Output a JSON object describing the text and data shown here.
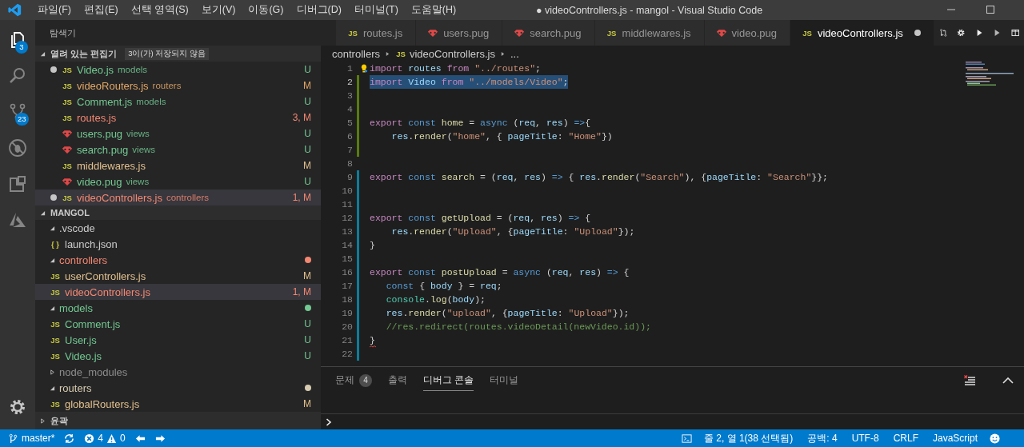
{
  "title_bar": {
    "menu": [
      "파일(F)",
      "편집(E)",
      "선택 영역(S)",
      "보기(V)",
      "이동(G)",
      "디버그(D)",
      "터미널(T)",
      "도움말(H)"
    ],
    "title": "● videoControllers.js - mangol - Visual Studio Code"
  },
  "activity_bar": [
    {
      "kind": "explorer",
      "selected": true,
      "badge": "3"
    },
    {
      "kind": "search",
      "selected": false
    },
    {
      "kind": "scm",
      "selected": false,
      "badge": "23"
    },
    {
      "kind": "debug",
      "selected": false
    },
    {
      "kind": "extensions",
      "selected": false
    },
    {
      "kind": "azure",
      "selected": false
    }
  ],
  "sidebar": {
    "title": "탐색기",
    "open_editors": {
      "title": "열려 있는 편집기",
      "expanded": true,
      "badge": "3이(가) 저장되지 않음",
      "items": [
        {
          "kind": "glyph",
          "icon": "JS",
          "name": "Video.js",
          "detail": "models",
          "status": "U",
          "color": "#73c991",
          "dirty": true,
          "selected": false
        },
        {
          "kind": "glyph",
          "icon": "JS",
          "name": "videoRouters.js",
          "detail": "routers",
          "status": "M",
          "color": "#e2a766",
          "dirty": false,
          "selected": false
        },
        {
          "kind": "glyph",
          "icon": "JS",
          "name": "Comment.js",
          "detail": "models",
          "status": "U",
          "color": "#73c991",
          "dirty": false,
          "selected": false
        },
        {
          "kind": "glyph",
          "icon": "JS",
          "name": "routes.js",
          "status": "3, M",
          "color": "#f48771",
          "dirty": false,
          "selected": false
        },
        {
          "kind": "pug",
          "name": "users.pug",
          "detail": "views",
          "status": "U",
          "color": "#73c991",
          "dirty": false,
          "selected": false
        },
        {
          "kind": "pug",
          "name": "search.pug",
          "detail": "views",
          "status": "U",
          "color": "#73c991",
          "dirty": false,
          "selected": false
        },
        {
          "kind": "glyph",
          "icon": "JS",
          "name": "middlewares.js",
          "status": "M",
          "color": "#e2c08d",
          "dirty": false,
          "selected": false
        },
        {
          "kind": "pug",
          "name": "video.pug",
          "detail": "views",
          "status": "U",
          "color": "#73c991",
          "dirty": false,
          "selected": false
        },
        {
          "kind": "glyph",
          "icon": "JS",
          "name": "videoControllers.js",
          "detail": "controllers",
          "status": "1, M",
          "color": "#f48771",
          "dirty": true,
          "selected": true
        }
      ]
    },
    "workspace": {
      "title": "MANGOL",
      "expanded": true,
      "tree": [
        {
          "kind": "folder",
          "name": ".vscode",
          "expanded": true,
          "color": "#cccccc",
          "children": [
            {
              "kind": "glyph",
              "icon": "{ }",
              "name": "launch.json",
              "color": "#cccccc",
              "selected": false
            }
          ]
        },
        {
          "kind": "folder",
          "name": "controllers",
          "expanded": true,
          "color": "#f48771",
          "dot": true,
          "children": [
            {
              "kind": "glyph",
              "icon": "JS",
              "name": "userControllers.js",
              "status": "M",
              "color": "#e2c08d",
              "selected": false
            },
            {
              "kind": "glyph",
              "icon": "JS",
              "name": "videoControllers.js",
              "status": "1, M",
              "color": "#f48771",
              "selected": true
            }
          ]
        },
        {
          "kind": "folder",
          "name": "models",
          "expanded": true,
          "color": "#73c991",
          "dot": true,
          "children": [
            {
              "kind": "glyph",
              "icon": "JS",
              "name": "Comment.js",
              "status": "U",
              "color": "#73c991",
              "selected": false
            },
            {
              "kind": "glyph",
              "icon": "JS",
              "name": "User.js",
              "status": "U",
              "color": "#73c991",
              "selected": false
            },
            {
              "kind": "glyph",
              "icon": "JS",
              "name": "Video.js",
              "status": "U",
              "color": "#73c991",
              "selected": false
            }
          ]
        },
        {
          "kind": "folder",
          "name": "node_modules",
          "expanded": false,
          "color": "#8c8c8c"
        },
        {
          "kind": "folder",
          "name": "routers",
          "expanded": true,
          "color": "#d7ccb0",
          "dot": true,
          "children": [
            {
              "kind": "glyph",
              "icon": "JS",
              "name": "globalRouters.js",
              "status": "M",
              "color": "#e2c08d",
              "selected": false
            }
          ]
        }
      ]
    },
    "outline": {
      "title": "윤곽",
      "expanded": false
    }
  },
  "tabs": [
    {
      "kind": "glyph",
      "icon": "JS",
      "name": "routes.js",
      "selected": false,
      "dirty": false
    },
    {
      "kind": "pug",
      "name": "users.pug",
      "selected": false,
      "dirty": false
    },
    {
      "kind": "pug",
      "name": "search.pug",
      "selected": false,
      "dirty": false
    },
    {
      "kind": "glyph",
      "icon": "JS",
      "name": "middlewares.js",
      "selected": false,
      "dirty": false
    },
    {
      "kind": "pug",
      "name": "video.pug",
      "selected": false,
      "dirty": false
    },
    {
      "kind": "glyph",
      "icon": "JS",
      "name": "videoControllers.js",
      "selected": true,
      "dirty": true
    }
  ],
  "breadcrumb": [
    {
      "kind": "folder",
      "text": "controllers"
    },
    {
      "kind": "glyph",
      "icon": "JS",
      "text": "videoControllers.js"
    },
    {
      "kind": "more",
      "text": "..."
    }
  ],
  "code": [
    {
      "n": "1",
      "kind": "plain",
      "selected": false,
      "error": false,
      "tokens": [
        {
          "kind": "keyword",
          "text": "import "
        },
        {
          "kind": "variable",
          "text": "routes "
        },
        {
          "kind": "keyword",
          "text": "from "
        },
        {
          "kind": "string",
          "text": "\"../routes\""
        },
        {
          "kind": "plain",
          "text": ";"
        }
      ]
    },
    {
      "n": "2",
      "kind": "added",
      "selected": true,
      "error": false,
      "tokens": [
        {
          "kind": "keyword",
          "text": "import "
        },
        {
          "kind": "variable",
          "text": "Video "
        },
        {
          "kind": "keyword",
          "text": "from "
        },
        {
          "kind": "string",
          "text": "\"../models/Video\""
        },
        {
          "kind": "plain",
          "text": ";"
        }
      ]
    },
    {
      "n": "3",
      "kind": "added",
      "selected": false,
      "error": false
    },
    {
      "n": "4",
      "kind": "added",
      "selected": false,
      "error": false
    },
    {
      "n": "5",
      "kind": "added",
      "selected": false,
      "error": false,
      "tokens": [
        {
          "kind": "keyword",
          "text": "export "
        },
        {
          "kind": "storage",
          "text": "const "
        },
        {
          "kind": "function",
          "text": "home "
        },
        {
          "kind": "plain",
          "text": "= "
        },
        {
          "kind": "storage",
          "text": "async "
        },
        {
          "kind": "plain",
          "text": "("
        },
        {
          "kind": "variable",
          "text": "req"
        },
        {
          "kind": "plain",
          "text": ", "
        },
        {
          "kind": "variable",
          "text": "res"
        },
        {
          "kind": "plain",
          "text": ") "
        },
        {
          "kind": "storage",
          "text": "=>"
        },
        {
          "kind": "plain",
          "text": "{"
        }
      ]
    },
    {
      "n": "6",
      "kind": "added",
      "selected": false,
      "error": false,
      "tokens": [
        {
          "kind": "variable",
          "text": "    res"
        },
        {
          "kind": "plain",
          "text": "."
        },
        {
          "kind": "function",
          "text": "render"
        },
        {
          "kind": "plain",
          "text": "("
        },
        {
          "kind": "string",
          "text": "\"home\""
        },
        {
          "kind": "plain",
          "text": ", { "
        },
        {
          "kind": "variable",
          "text": "pageTitle"
        },
        {
          "kind": "plain",
          "text": ": "
        },
        {
          "kind": "string",
          "text": "\"Home\""
        },
        {
          "kind": "plain",
          "text": "})"
        }
      ]
    },
    {
      "n": "7",
      "kind": "added",
      "selected": false,
      "error": false
    },
    {
      "n": "8",
      "kind": "plain",
      "selected": false,
      "error": false
    },
    {
      "n": "9",
      "kind": "modified",
      "selected": false,
      "error": false,
      "tokens": [
        {
          "kind": "keyword",
          "text": "export "
        },
        {
          "kind": "storage",
          "text": "const "
        },
        {
          "kind": "function",
          "text": "search "
        },
        {
          "kind": "plain",
          "text": "= ("
        },
        {
          "kind": "variable",
          "text": "req"
        },
        {
          "kind": "plain",
          "text": ", "
        },
        {
          "kind": "variable",
          "text": "res"
        },
        {
          "kind": "plain",
          "text": ") "
        },
        {
          "kind": "storage",
          "text": "=>"
        },
        {
          "kind": "plain",
          "text": " { "
        },
        {
          "kind": "variable",
          "text": "res"
        },
        {
          "kind": "plain",
          "text": "."
        },
        {
          "kind": "function",
          "text": "render"
        },
        {
          "kind": "plain",
          "text": "("
        },
        {
          "kind": "string",
          "text": "\"Search\""
        },
        {
          "kind": "plain",
          "text": "), {"
        },
        {
          "kind": "variable",
          "text": "pageTitle"
        },
        {
          "kind": "plain",
          "text": ": "
        },
        {
          "kind": "string",
          "text": "\"Search\""
        },
        {
          "kind": "plain",
          "text": "}};"
        }
      ]
    },
    {
      "n": "10",
      "kind": "modified",
      "selected": false,
      "error": false
    },
    {
      "n": "11",
      "kind": "modified",
      "selected": false,
      "error": false
    },
    {
      "n": "12",
      "kind": "modified",
      "selected": false,
      "error": false,
      "tokens": [
        {
          "kind": "keyword",
          "text": "export "
        },
        {
          "kind": "storage",
          "text": "const "
        },
        {
          "kind": "function",
          "text": "getUpload "
        },
        {
          "kind": "plain",
          "text": "= ("
        },
        {
          "kind": "variable",
          "text": "req"
        },
        {
          "kind": "plain",
          "text": ", "
        },
        {
          "kind": "variable",
          "text": "res"
        },
        {
          "kind": "plain",
          "text": ") "
        },
        {
          "kind": "storage",
          "text": "=>"
        },
        {
          "kind": "plain",
          "text": " {"
        }
      ]
    },
    {
      "n": "13",
      "kind": "modified",
      "selected": false,
      "error": false,
      "tokens": [
        {
          "kind": "variable",
          "text": "    res"
        },
        {
          "kind": "plain",
          "text": "."
        },
        {
          "kind": "function",
          "text": "render"
        },
        {
          "kind": "plain",
          "text": "("
        },
        {
          "kind": "string",
          "text": "\"Upload\""
        },
        {
          "kind": "plain",
          "text": ", {"
        },
        {
          "kind": "variable",
          "text": "pageTitle"
        },
        {
          "kind": "plain",
          "text": ": "
        },
        {
          "kind": "string",
          "text": "\"Upload\""
        },
        {
          "kind": "plain",
          "text": "});"
        }
      ]
    },
    {
      "n": "14",
      "kind": "modified",
      "selected": false,
      "error": false,
      "tokens": [
        {
          "kind": "plain",
          "text": "}"
        }
      ]
    },
    {
      "n": "15",
      "kind": "modified",
      "selected": false,
      "error": false
    },
    {
      "n": "16",
      "kind": "modified",
      "selected": false,
      "error": false,
      "tokens": [
        {
          "kind": "keyword",
          "text": "export "
        },
        {
          "kind": "storage",
          "text": "const "
        },
        {
          "kind": "function",
          "text": "postUpload "
        },
        {
          "kind": "plain",
          "text": "= "
        },
        {
          "kind": "storage",
          "text": "async "
        },
        {
          "kind": "plain",
          "text": "("
        },
        {
          "kind": "variable",
          "text": "req"
        },
        {
          "kind": "plain",
          "text": ", "
        },
        {
          "kind": "variable",
          "text": "res"
        },
        {
          "kind": "plain",
          "text": ") "
        },
        {
          "kind": "storage",
          "text": "=>"
        },
        {
          "kind": "plain",
          "text": " {"
        }
      ]
    },
    {
      "n": "17",
      "kind": "modified",
      "selected": false,
      "error": false,
      "tokens": [
        {
          "kind": "storage",
          "text": "   const "
        },
        {
          "kind": "plain",
          "text": "{ "
        },
        {
          "kind": "variable",
          "text": "body "
        },
        {
          "kind": "plain",
          "text": "} = "
        },
        {
          "kind": "variable",
          "text": "req"
        },
        {
          "kind": "plain",
          "text": ";"
        }
      ]
    },
    {
      "n": "18",
      "kind": "modified",
      "selected": false,
      "error": false,
      "tokens": [
        {
          "kind": "type",
          "text": "   console"
        },
        {
          "kind": "plain",
          "text": "."
        },
        {
          "kind": "function",
          "text": "log"
        },
        {
          "kind": "plain",
          "text": "("
        },
        {
          "kind": "variable",
          "text": "body"
        },
        {
          "kind": "plain",
          "text": ");"
        }
      ]
    },
    {
      "n": "19",
      "kind": "modified",
      "selected": false,
      "error": false,
      "tokens": [
        {
          "kind": "variable",
          "text": "   res"
        },
        {
          "kind": "plain",
          "text": "."
        },
        {
          "kind": "function",
          "text": "render"
        },
        {
          "kind": "plain",
          "text": "("
        },
        {
          "kind": "string",
          "text": "\"upload\""
        },
        {
          "kind": "plain",
          "text": ", {"
        },
        {
          "kind": "variable",
          "text": "pageTitle"
        },
        {
          "kind": "plain",
          "text": ": "
        },
        {
          "kind": "string",
          "text": "\"Upload\""
        },
        {
          "kind": "plain",
          "text": "});"
        }
      ]
    },
    {
      "n": "20",
      "kind": "modified",
      "selected": false,
      "error": false,
      "tokens": [
        {
          "kind": "comment",
          "text": "   //res.redirect(routes.videoDetail(newVideo.id));"
        }
      ]
    },
    {
      "n": "21",
      "kind": "modified",
      "selected": false,
      "error": true,
      "tokens": [
        {
          "kind": "plain",
          "text": "}"
        }
      ]
    },
    {
      "n": "22",
      "kind": "modified",
      "selected": false,
      "error": false
    }
  ],
  "panel": {
    "tabs": [
      {
        "label": "문제",
        "badge": "4",
        "selected": false
      },
      {
        "label": "출력",
        "selected": false
      },
      {
        "label": "디버그 콘솔",
        "selected": true
      },
      {
        "label": "터미널",
        "selected": false
      }
    ]
  },
  "status_bar": {
    "branch": "master*",
    "errors": "4",
    "warnings": "0",
    "position": "줄 2, 열 1(38 선택됨)",
    "indent": "공백: 4",
    "encoding": "UTF-8",
    "eol": "CRLF",
    "language": "JavaScript"
  }
}
